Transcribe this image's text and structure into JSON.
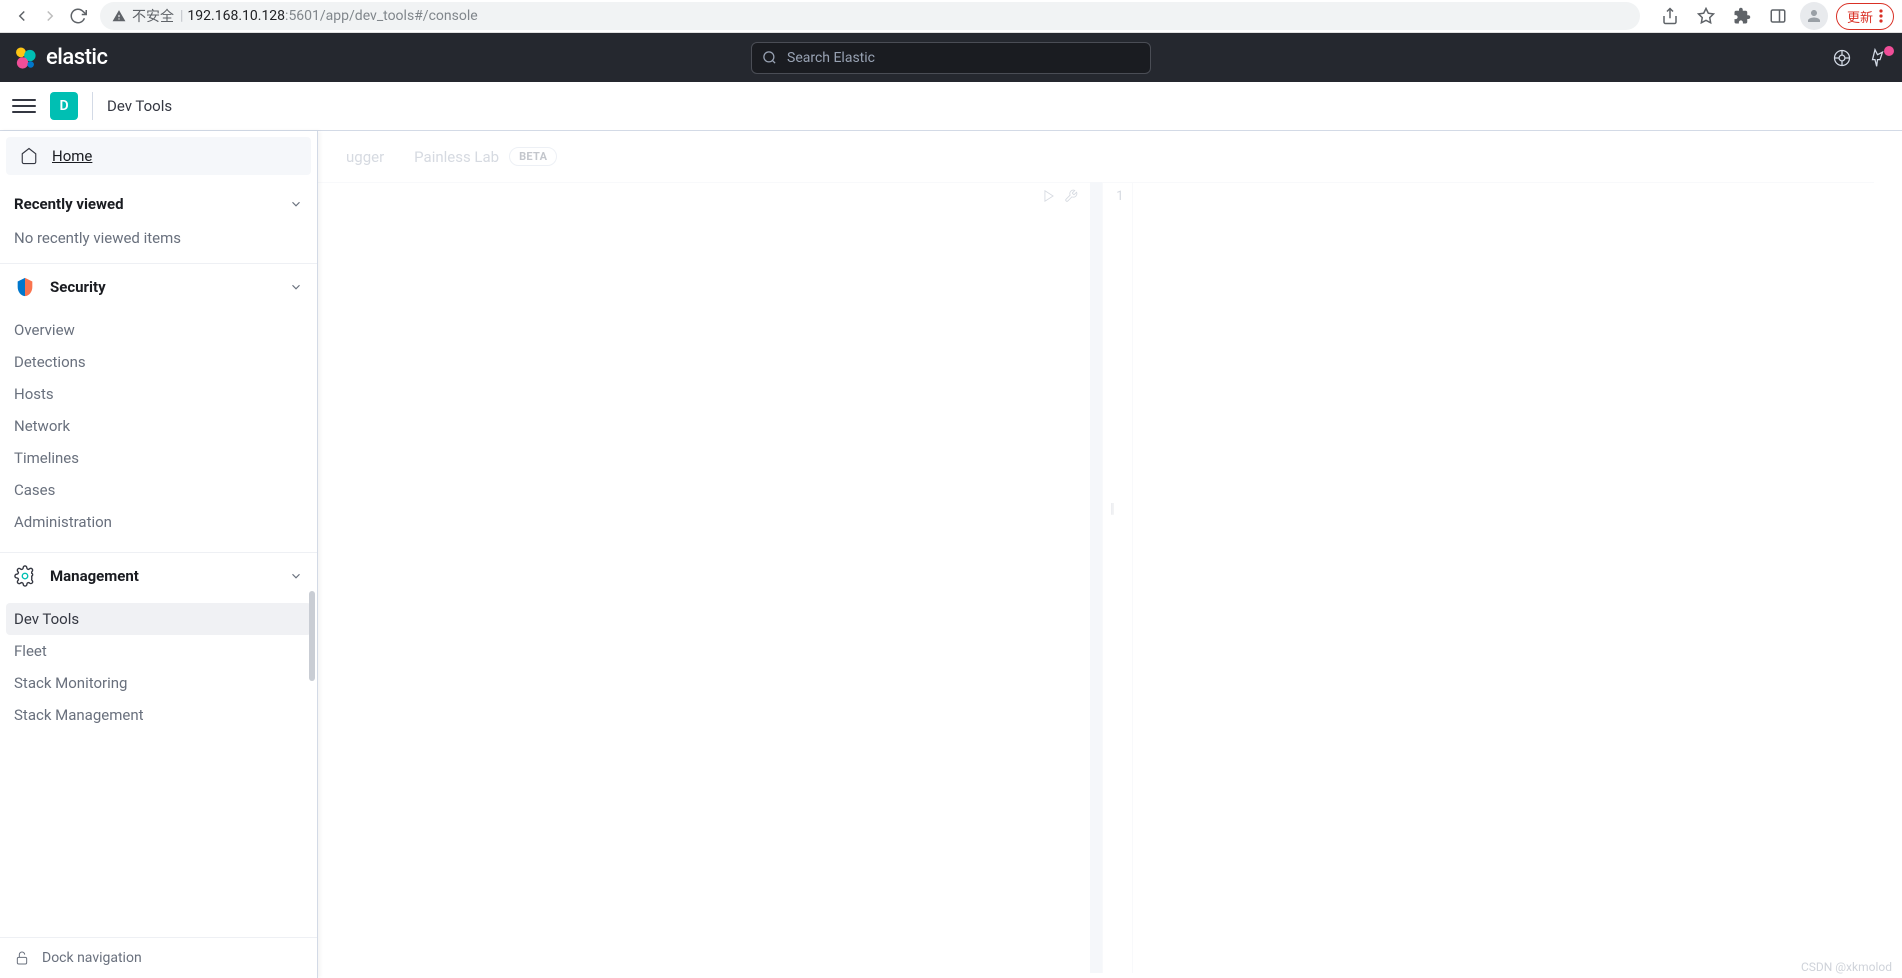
{
  "browser": {
    "not_secure": "不安全",
    "url_host": "192.168.10.128",
    "url_path": ":5601/app/dev_tools#/console",
    "update": "更新"
  },
  "header": {
    "search_placeholder": "Search Elastic",
    "logo_text": "elastic"
  },
  "subheader": {
    "badge_letter": "D",
    "breadcrumb": "Dev Tools"
  },
  "sidenav": {
    "home": "Home",
    "recently_viewed": "Recently viewed",
    "no_recent": "No recently viewed items",
    "security": {
      "title": "Security",
      "items": [
        "Overview",
        "Detections",
        "Hosts",
        "Network",
        "Timelines",
        "Cases",
        "Administration"
      ]
    },
    "management": {
      "title": "Management",
      "items": [
        "Dev Tools",
        "Fleet",
        "Stack Monitoring",
        "Stack Management"
      ]
    },
    "dock": "Dock navigation"
  },
  "content": {
    "tab_partial": "ugger",
    "tab_painless": "Painless Lab",
    "beta": "BETA",
    "line1": "1"
  },
  "watermark": "CSDN @xkmolod"
}
